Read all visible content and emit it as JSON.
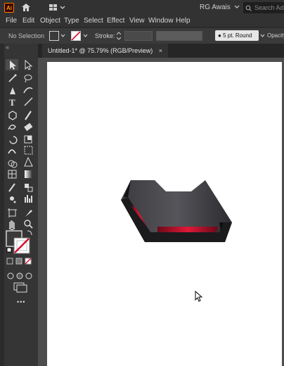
{
  "app": {
    "logo_text": "Ai",
    "user_name": "RG Awais",
    "search_placeholder": "Search Adobe Stock"
  },
  "menu": [
    "File",
    "Edit",
    "Object",
    "Type",
    "Select",
    "Effect",
    "View",
    "Window",
    "Help"
  ],
  "control_bar": {
    "selection_label": "No Selection",
    "stroke_label": "Stroke:",
    "brush_label": "5 pt. Round",
    "opacity_label": "Opacity"
  },
  "document_tab": {
    "title": "Untitled-1* @ 75.79% (RGB/Preview)",
    "close_glyph": "×"
  },
  "tools": {
    "more_glyph": "•••",
    "collapse_glyph": "«"
  },
  "colors": {
    "accent_red": "#d01030",
    "object_dark": "#2a2a2d",
    "artboard": "#ffffff"
  }
}
